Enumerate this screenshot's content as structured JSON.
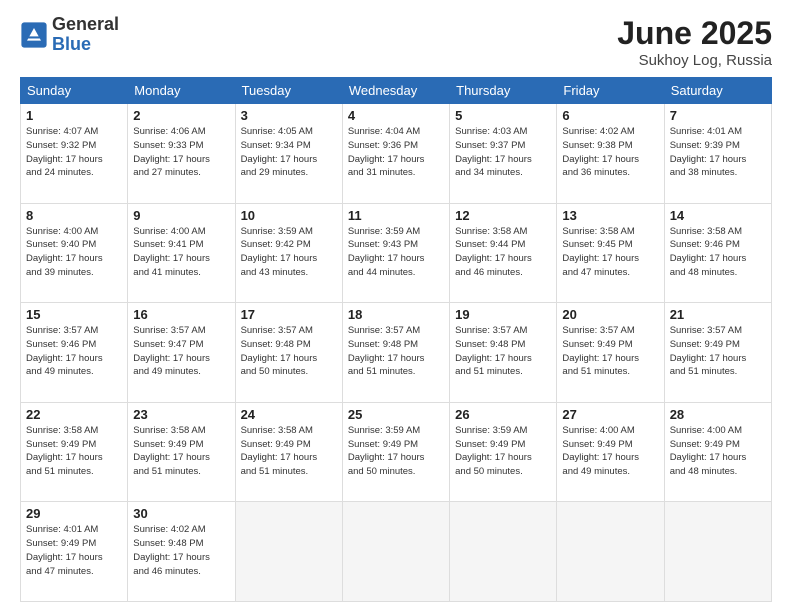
{
  "header": {
    "logo_general": "General",
    "logo_blue": "Blue",
    "title": "June 2025",
    "location": "Sukhoy Log, Russia"
  },
  "days_of_week": [
    "Sunday",
    "Monday",
    "Tuesday",
    "Wednesday",
    "Thursday",
    "Friday",
    "Saturday"
  ],
  "weeks": [
    [
      {
        "day": "1",
        "info": "Sunrise: 4:07 AM\nSunset: 9:32 PM\nDaylight: 17 hours\nand 24 minutes."
      },
      {
        "day": "2",
        "info": "Sunrise: 4:06 AM\nSunset: 9:33 PM\nDaylight: 17 hours\nand 27 minutes."
      },
      {
        "day": "3",
        "info": "Sunrise: 4:05 AM\nSunset: 9:34 PM\nDaylight: 17 hours\nand 29 minutes."
      },
      {
        "day": "4",
        "info": "Sunrise: 4:04 AM\nSunset: 9:36 PM\nDaylight: 17 hours\nand 31 minutes."
      },
      {
        "day": "5",
        "info": "Sunrise: 4:03 AM\nSunset: 9:37 PM\nDaylight: 17 hours\nand 34 minutes."
      },
      {
        "day": "6",
        "info": "Sunrise: 4:02 AM\nSunset: 9:38 PM\nDaylight: 17 hours\nand 36 minutes."
      },
      {
        "day": "7",
        "info": "Sunrise: 4:01 AM\nSunset: 9:39 PM\nDaylight: 17 hours\nand 38 minutes."
      }
    ],
    [
      {
        "day": "8",
        "info": "Sunrise: 4:00 AM\nSunset: 9:40 PM\nDaylight: 17 hours\nand 39 minutes."
      },
      {
        "day": "9",
        "info": "Sunrise: 4:00 AM\nSunset: 9:41 PM\nDaylight: 17 hours\nand 41 minutes."
      },
      {
        "day": "10",
        "info": "Sunrise: 3:59 AM\nSunset: 9:42 PM\nDaylight: 17 hours\nand 43 minutes."
      },
      {
        "day": "11",
        "info": "Sunrise: 3:59 AM\nSunset: 9:43 PM\nDaylight: 17 hours\nand 44 minutes."
      },
      {
        "day": "12",
        "info": "Sunrise: 3:58 AM\nSunset: 9:44 PM\nDaylight: 17 hours\nand 46 minutes."
      },
      {
        "day": "13",
        "info": "Sunrise: 3:58 AM\nSunset: 9:45 PM\nDaylight: 17 hours\nand 47 minutes."
      },
      {
        "day": "14",
        "info": "Sunrise: 3:58 AM\nSunset: 9:46 PM\nDaylight: 17 hours\nand 48 minutes."
      }
    ],
    [
      {
        "day": "15",
        "info": "Sunrise: 3:57 AM\nSunset: 9:46 PM\nDaylight: 17 hours\nand 49 minutes."
      },
      {
        "day": "16",
        "info": "Sunrise: 3:57 AM\nSunset: 9:47 PM\nDaylight: 17 hours\nand 49 minutes."
      },
      {
        "day": "17",
        "info": "Sunrise: 3:57 AM\nSunset: 9:48 PM\nDaylight: 17 hours\nand 50 minutes."
      },
      {
        "day": "18",
        "info": "Sunrise: 3:57 AM\nSunset: 9:48 PM\nDaylight: 17 hours\nand 51 minutes."
      },
      {
        "day": "19",
        "info": "Sunrise: 3:57 AM\nSunset: 9:48 PM\nDaylight: 17 hours\nand 51 minutes."
      },
      {
        "day": "20",
        "info": "Sunrise: 3:57 AM\nSunset: 9:49 PM\nDaylight: 17 hours\nand 51 minutes."
      },
      {
        "day": "21",
        "info": "Sunrise: 3:57 AM\nSunset: 9:49 PM\nDaylight: 17 hours\nand 51 minutes."
      }
    ],
    [
      {
        "day": "22",
        "info": "Sunrise: 3:58 AM\nSunset: 9:49 PM\nDaylight: 17 hours\nand 51 minutes."
      },
      {
        "day": "23",
        "info": "Sunrise: 3:58 AM\nSunset: 9:49 PM\nDaylight: 17 hours\nand 51 minutes."
      },
      {
        "day": "24",
        "info": "Sunrise: 3:58 AM\nSunset: 9:49 PM\nDaylight: 17 hours\nand 51 minutes."
      },
      {
        "day": "25",
        "info": "Sunrise: 3:59 AM\nSunset: 9:49 PM\nDaylight: 17 hours\nand 50 minutes."
      },
      {
        "day": "26",
        "info": "Sunrise: 3:59 AM\nSunset: 9:49 PM\nDaylight: 17 hours\nand 50 minutes."
      },
      {
        "day": "27",
        "info": "Sunrise: 4:00 AM\nSunset: 9:49 PM\nDaylight: 17 hours\nand 49 minutes."
      },
      {
        "day": "28",
        "info": "Sunrise: 4:00 AM\nSunset: 9:49 PM\nDaylight: 17 hours\nand 48 minutes."
      }
    ],
    [
      {
        "day": "29",
        "info": "Sunrise: 4:01 AM\nSunset: 9:49 PM\nDaylight: 17 hours\nand 47 minutes."
      },
      {
        "day": "30",
        "info": "Sunrise: 4:02 AM\nSunset: 9:48 PM\nDaylight: 17 hours\nand 46 minutes."
      },
      {
        "day": "",
        "info": ""
      },
      {
        "day": "",
        "info": ""
      },
      {
        "day": "",
        "info": ""
      },
      {
        "day": "",
        "info": ""
      },
      {
        "day": "",
        "info": ""
      }
    ]
  ]
}
